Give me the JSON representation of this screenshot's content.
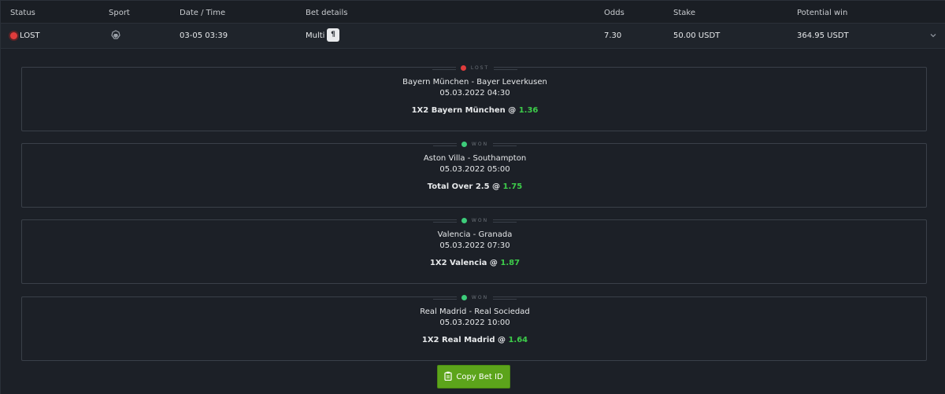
{
  "table": {
    "headers": {
      "status": "Status",
      "sport": "Sport",
      "datetime": "Date / Time",
      "details": "Bet details",
      "odds": "Odds",
      "stake": "Stake",
      "potential_win": "Potential win"
    }
  },
  "bet": {
    "status": "LOST",
    "status_color": "#e03c3c",
    "sport_icon": "soccer-icon",
    "datetime": "03-05 03:39",
    "type": "Multi",
    "type_badge": "¶",
    "odds": "7.30",
    "stake": "50.00 USDT",
    "potential_win": "364.95 USDT"
  },
  "legs": [
    {
      "status": "LOST",
      "status_color": "#e03c3c",
      "teams": "Bayern München - Bayer Leverkusen",
      "time": "05.03.2022 04:30",
      "pick": "1X2 Bayern München @ ",
      "odds": "1.36"
    },
    {
      "status": "WON",
      "status_color": "#3dcc7a",
      "teams": "Aston Villa - Southampton",
      "time": "05.03.2022 05:00",
      "pick": "Total Over 2.5 @ ",
      "odds": "1.75"
    },
    {
      "status": "WON",
      "status_color": "#3dcc7a",
      "teams": "Valencia - Granada",
      "time": "05.03.2022 07:30",
      "pick": "1X2 Valencia @ ",
      "odds": "1.87"
    },
    {
      "status": "WON",
      "status_color": "#3dcc7a",
      "teams": "Real Madrid - Real Sociedad",
      "time": "05.03.2022 10:00",
      "pick": "1X2 Real Madrid @ ",
      "odds": "1.64"
    }
  ],
  "actions": {
    "copy_label": "Copy Bet ID",
    "copy_icon": "clipboard-icon",
    "accent": "#5ca41b"
  }
}
